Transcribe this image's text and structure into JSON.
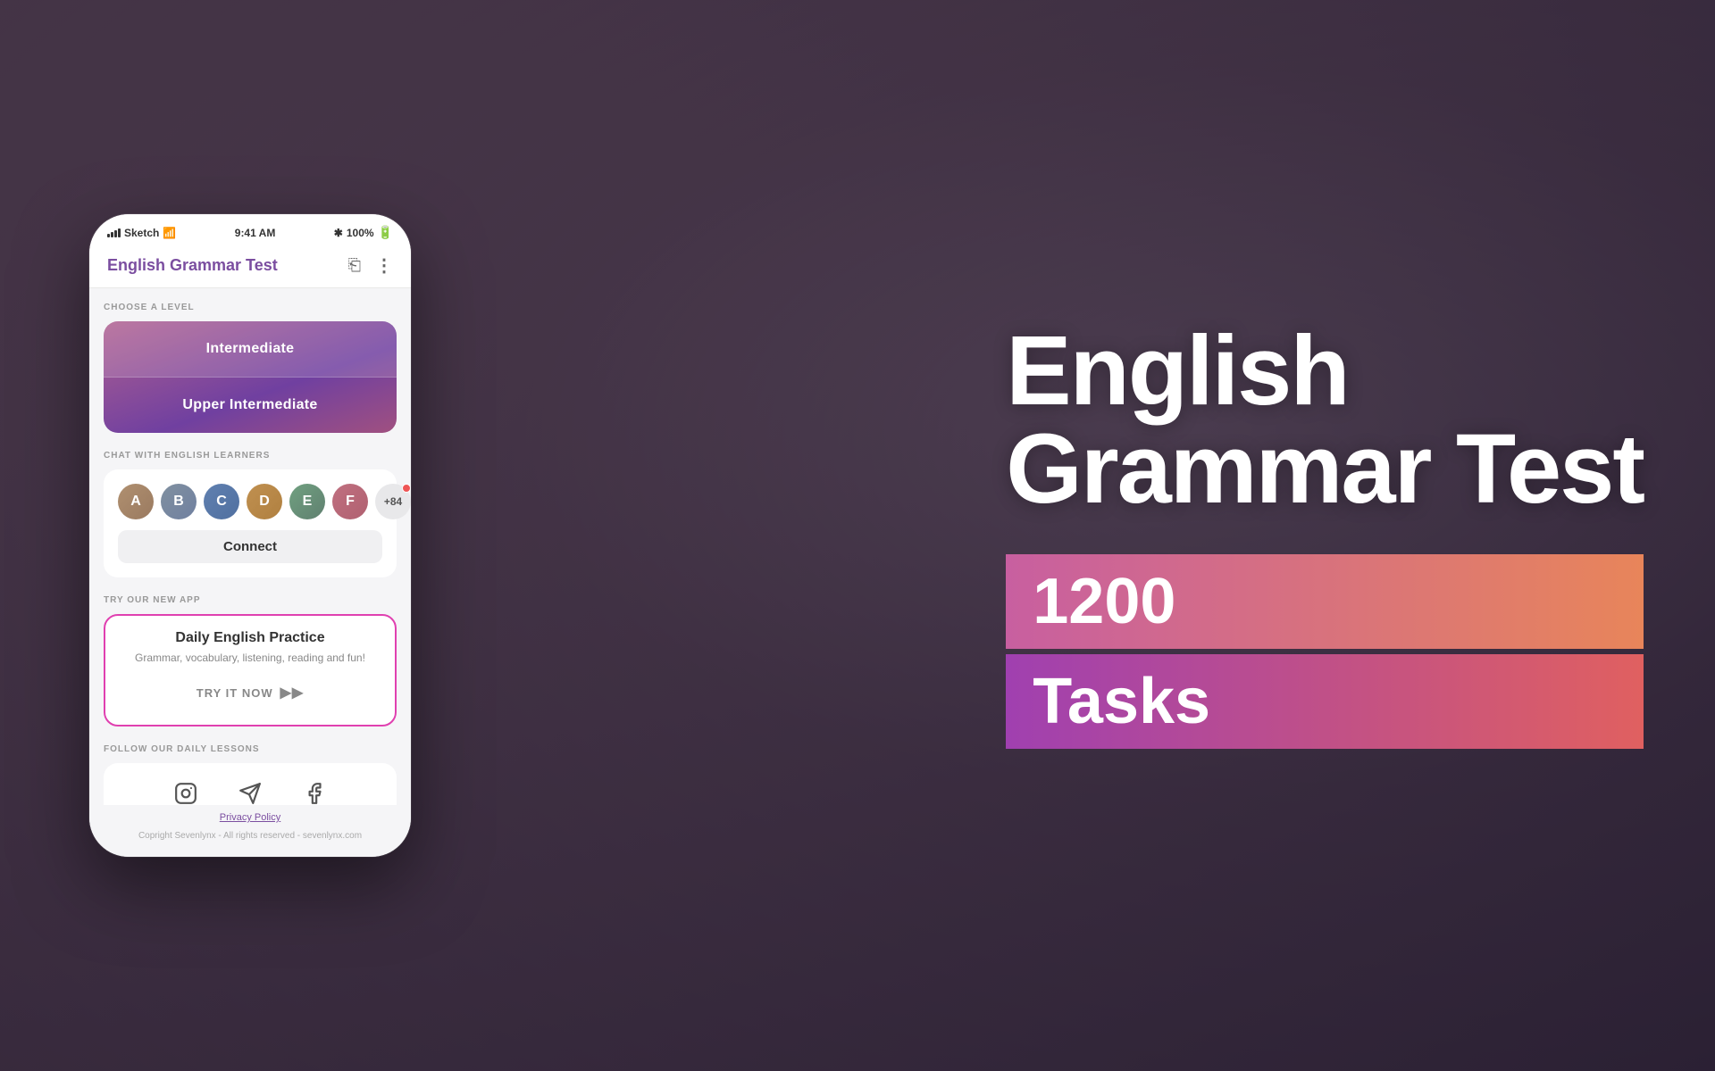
{
  "background": {
    "color": "#5a4a5a"
  },
  "right_content": {
    "main_title": "English\nGrammar Test",
    "number": "1200",
    "tasks_label": "Tasks"
  },
  "phone": {
    "status_bar": {
      "carrier": "Sketch",
      "time": "9:41 AM",
      "battery": "100%"
    },
    "header": {
      "title": "English Grammar Test",
      "share_icon": "share",
      "more_icon": "more"
    },
    "choose_level": {
      "section_label": "CHOOSE A LEVEL",
      "levels": [
        {
          "label": "Intermediate",
          "active": true
        },
        {
          "label": "Upper Intermediate",
          "active": false
        }
      ]
    },
    "chat_section": {
      "section_label": "CHAT WITH ENGLISH LEARNERS",
      "avatars": [
        {
          "initials": "A",
          "color": "#b0876a"
        },
        {
          "initials": "B",
          "color": "#8a9ab0"
        },
        {
          "initials": "C",
          "color": "#6a8ab0"
        },
        {
          "initials": "D",
          "color": "#c09060"
        },
        {
          "initials": "E",
          "color": "#80a080"
        },
        {
          "initials": "F",
          "color": "#c07080"
        }
      ],
      "extra_count": "+84",
      "connect_button": "Connect"
    },
    "promo_section": {
      "section_label": "TRY OUR NEW APP",
      "title": "Daily English Practice",
      "subtitle": "Grammar, vocabulary, listening, reading and fun!",
      "cta": "TRY IT NOW"
    },
    "follow_section": {
      "section_label": "FOLLOW OUR DAILY LESSONS",
      "socials": [
        "instagram",
        "telegram",
        "facebook"
      ]
    },
    "footer": {
      "privacy": "Privacy Policy",
      "copyright": "Copright Sevenlynx - All rights reserved - sevenlynx.com"
    }
  }
}
